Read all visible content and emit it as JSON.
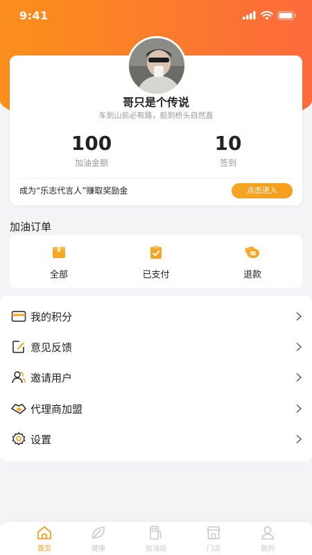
{
  "status_bar": {
    "time": "9:41"
  },
  "profile": {
    "nickname": "哥只是个传说",
    "signature": "车到山前必有路，船到桥头自然直",
    "stats": [
      {
        "value": "100",
        "label": "加油金额"
      },
      {
        "value": "10",
        "label": "签到"
      }
    ],
    "ambassador_text": "成为“乐志代言人”赚取奖励金",
    "enter_button": "点击进入"
  },
  "orders": {
    "title": "加油订单",
    "items": [
      {
        "label": "全部",
        "icon": "box-icon"
      },
      {
        "label": "已支付",
        "icon": "paid-clipboard-icon"
      },
      {
        "label": "退款",
        "icon": "refund-icon"
      }
    ]
  },
  "menu": {
    "items": [
      {
        "label": "我的积分",
        "icon": "card-icon"
      },
      {
        "label": "意见反馈",
        "icon": "edit-icon"
      },
      {
        "label": "邀请用户",
        "icon": "users-icon"
      },
      {
        "label": "代理商加盟",
        "icon": "handshake-icon"
      },
      {
        "label": "设置",
        "icon": "gear-icon"
      }
    ]
  },
  "tab_bar": {
    "active_color": "#f29b1a",
    "inactive_color": "#c7c7c7",
    "tabs": [
      {
        "label": "首页",
        "icon": "home-icon",
        "active": true
      },
      {
        "label": "健康",
        "icon": "leaf-icon",
        "active": false
      },
      {
        "label": "加油站",
        "icon": "fuel-pump-icon",
        "active": false
      },
      {
        "label": "门店",
        "icon": "store-icon",
        "active": false
      },
      {
        "label": "我的",
        "icon": "person-icon",
        "active": false
      }
    ]
  },
  "colors": {
    "header_gradient_start": "#fb8f1b",
    "header_gradient_end": "#fd6a3c",
    "accent": "#f6a524"
  }
}
